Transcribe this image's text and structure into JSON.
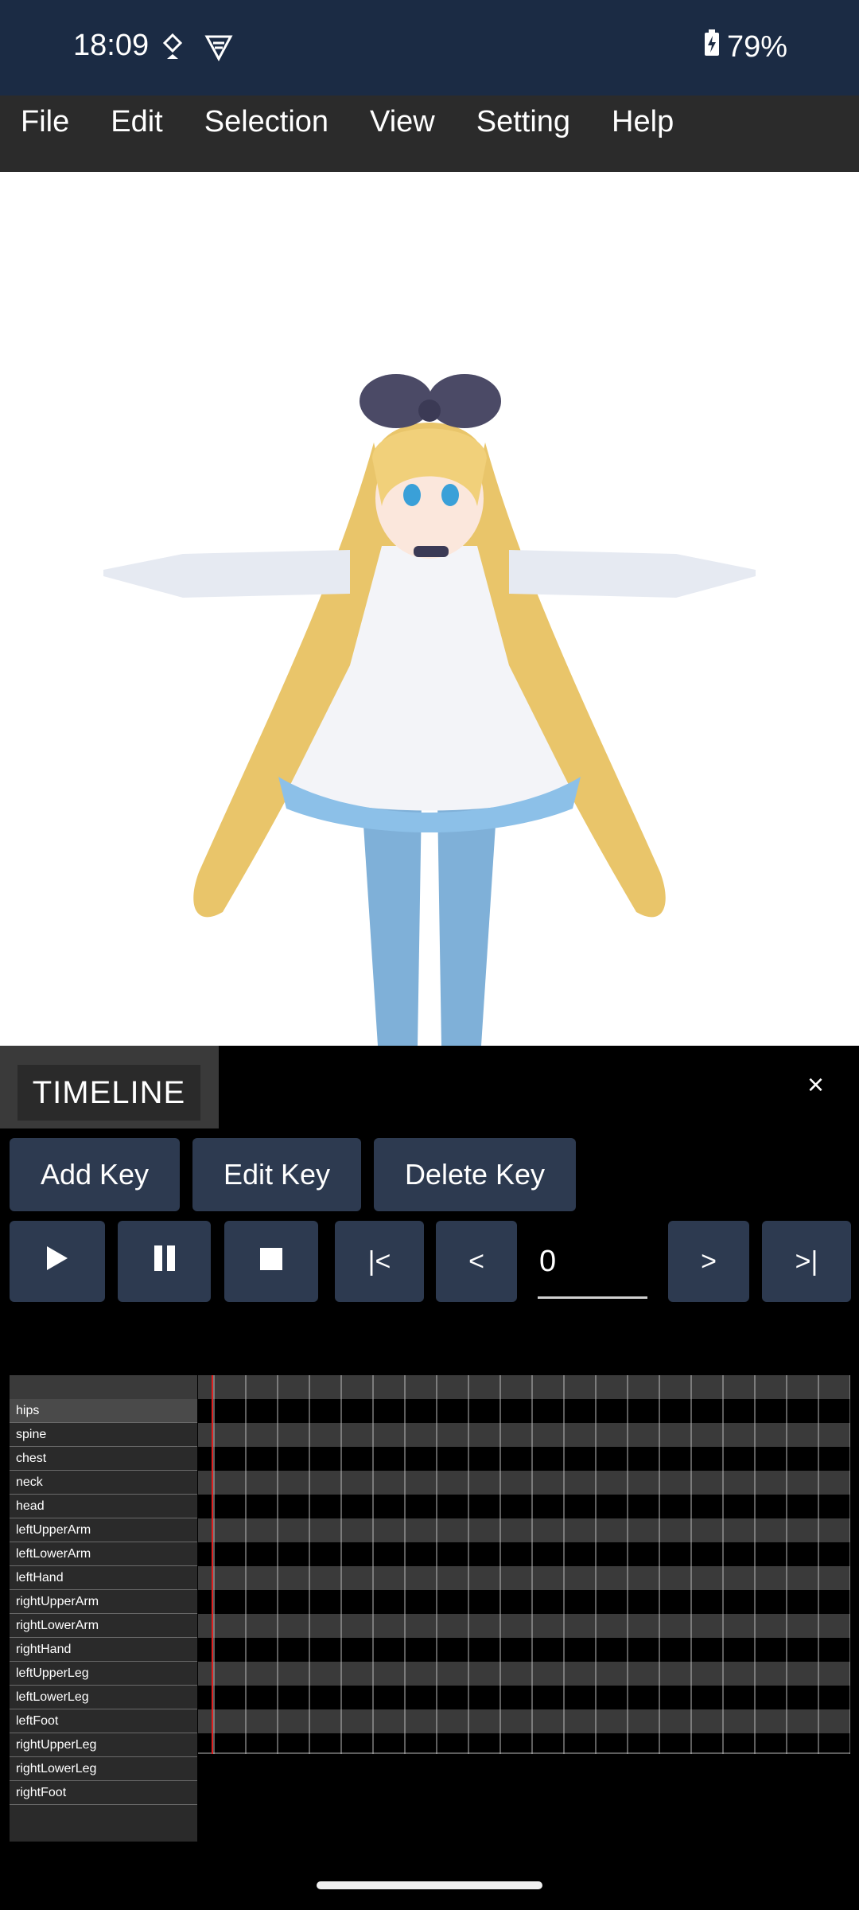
{
  "status": {
    "time": "18:09",
    "battery": "79%"
  },
  "menu": [
    "File",
    "Edit",
    "Selection",
    "View",
    "Setting",
    "Help"
  ],
  "timeline": {
    "title": "TIMELINE",
    "close_label": "×",
    "key_buttons": [
      "Add Key",
      "Edit Key",
      "Delete Key"
    ],
    "first_label": "|<",
    "prev_label": "<",
    "next_label": ">",
    "last_label": ">|",
    "frame_value": "0",
    "bones": [
      "hips",
      "spine",
      "chest",
      "neck",
      "head",
      "leftUpperArm",
      "leftLowerArm",
      "leftHand",
      "rightUpperArm",
      "rightLowerArm",
      "rightHand",
      "leftUpperLeg",
      "leftLowerLeg",
      "leftFoot",
      "rightUpperLeg",
      "rightLowerLeg",
      "rightFoot"
    ],
    "selected_bone": "hips",
    "current_frame": 0
  },
  "colors": {
    "status_bg": "#1b2b44",
    "menu_bg": "#2b2b2b",
    "button_bg": "#2d3a50",
    "playhead": "#e02020"
  }
}
